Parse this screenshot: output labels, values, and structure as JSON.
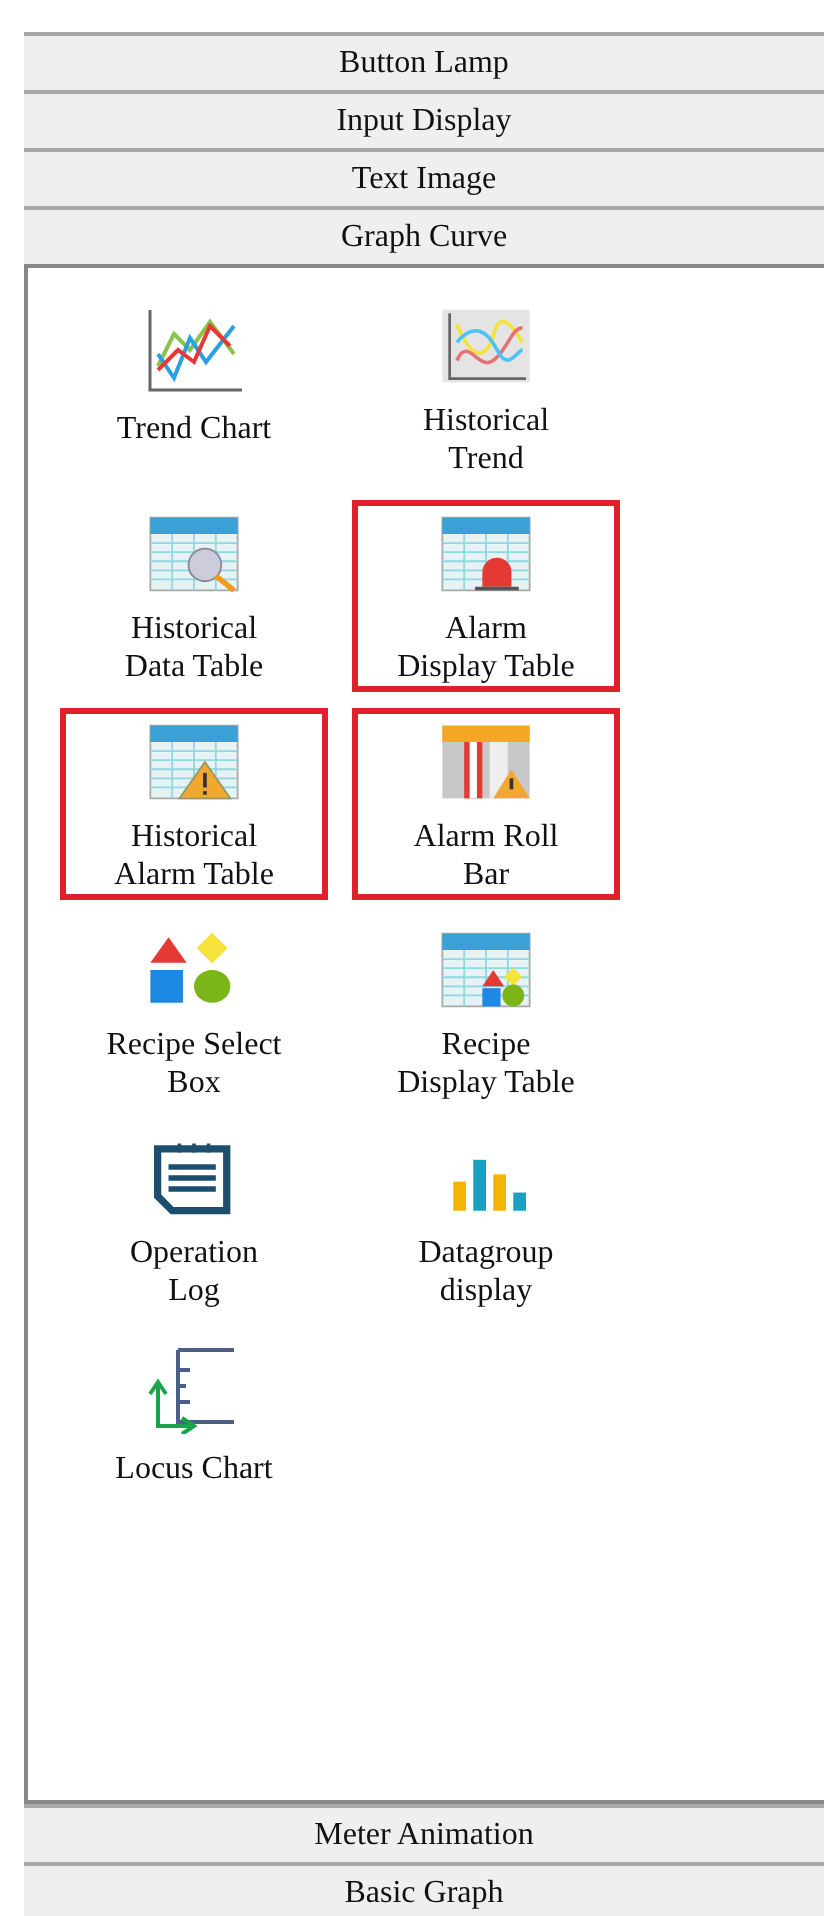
{
  "sections": [
    {
      "title": "Button Lamp"
    },
    {
      "title": "Input Display"
    },
    {
      "title": "Text Image"
    },
    {
      "title": "Graph Curve",
      "items": [
        {
          "label": "Trend Chart",
          "kind": "trend",
          "highlighted": false
        },
        {
          "label": "Historical\nTrend",
          "kind": "historytrend",
          "highlighted": false
        },
        {
          "label": "Historical\nData Table",
          "kind": "datatable",
          "highlighted": false
        },
        {
          "label": "Alarm\nDisplay Table",
          "kind": "alarmtable",
          "highlighted": true
        },
        {
          "label": "Historical\nAlarm Table",
          "kind": "warningtable",
          "highlighted": true
        },
        {
          "label": "Alarm Roll\nBar",
          "kind": "rollbar",
          "highlighted": true
        },
        {
          "label": "Recipe Select\nBox",
          "kind": "shapes",
          "highlighted": false
        },
        {
          "label": "Recipe\nDisplay Table",
          "kind": "shapestable",
          "highlighted": false
        },
        {
          "label": "Operation\nLog",
          "kind": "notepad",
          "highlighted": false
        },
        {
          "label": "Datagroup\ndisplay",
          "kind": "bars",
          "highlighted": false
        },
        {
          "label": "Locus Chart",
          "kind": "locus",
          "highlighted": false
        }
      ]
    },
    {
      "title": "Meter Animation"
    },
    {
      "title": "Basic Graph"
    }
  ]
}
